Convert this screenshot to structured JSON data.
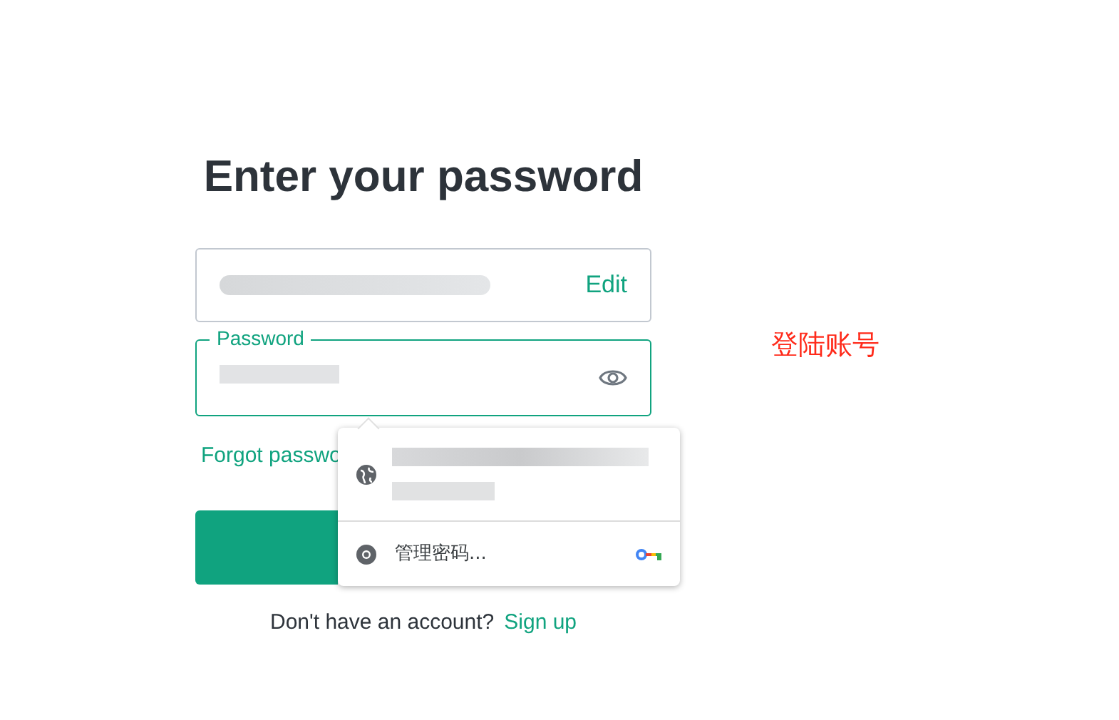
{
  "heading": "Enter your password",
  "email_field": {
    "action": "Edit"
  },
  "password_field": {
    "label": "Password"
  },
  "forgot_link": "Forgot passwo",
  "autofill_popup": {
    "manage_label": "管理密码..."
  },
  "signup_prompt": {
    "text": "Don't have an account?",
    "link": "Sign up"
  },
  "annotation": "登陆账号"
}
